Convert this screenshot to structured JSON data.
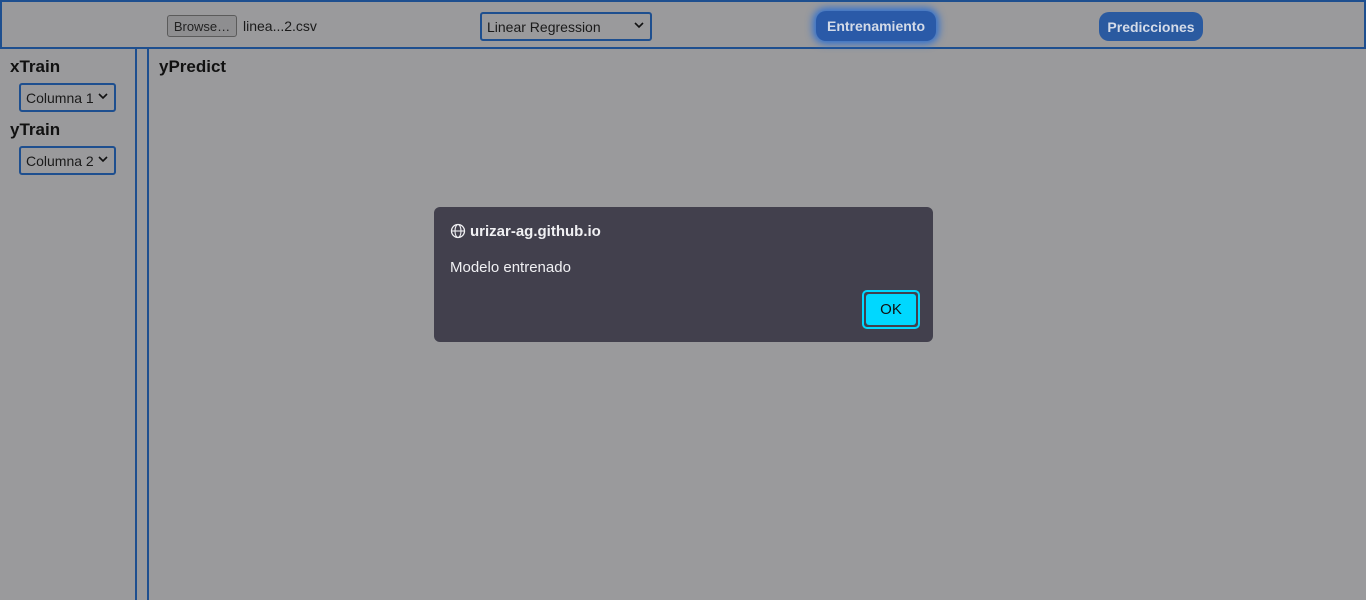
{
  "topbar": {
    "browse_label": "Browse…",
    "file_name": "linea...2.csv",
    "model_select_value": "Linear Regression",
    "train_button": "Entrenamiento",
    "predict_button": "Predicciones"
  },
  "sidebar": {
    "xtrain_label": "xTrain",
    "xtrain_value": "Columna 1",
    "ytrain_label": "yTrain",
    "ytrain_value": "Columna 2"
  },
  "main": {
    "ypredict_label": "yPredict"
  },
  "dialog": {
    "origin": "urizar-ag.github.io",
    "message": "Modelo entrenado",
    "ok_label": "OK",
    "icon": "globe-icon"
  },
  "colors": {
    "accent": "#1e4f8f",
    "button": "#2a5aa8",
    "dialog_bg": "#42404d",
    "ok": "#00d8ff"
  }
}
